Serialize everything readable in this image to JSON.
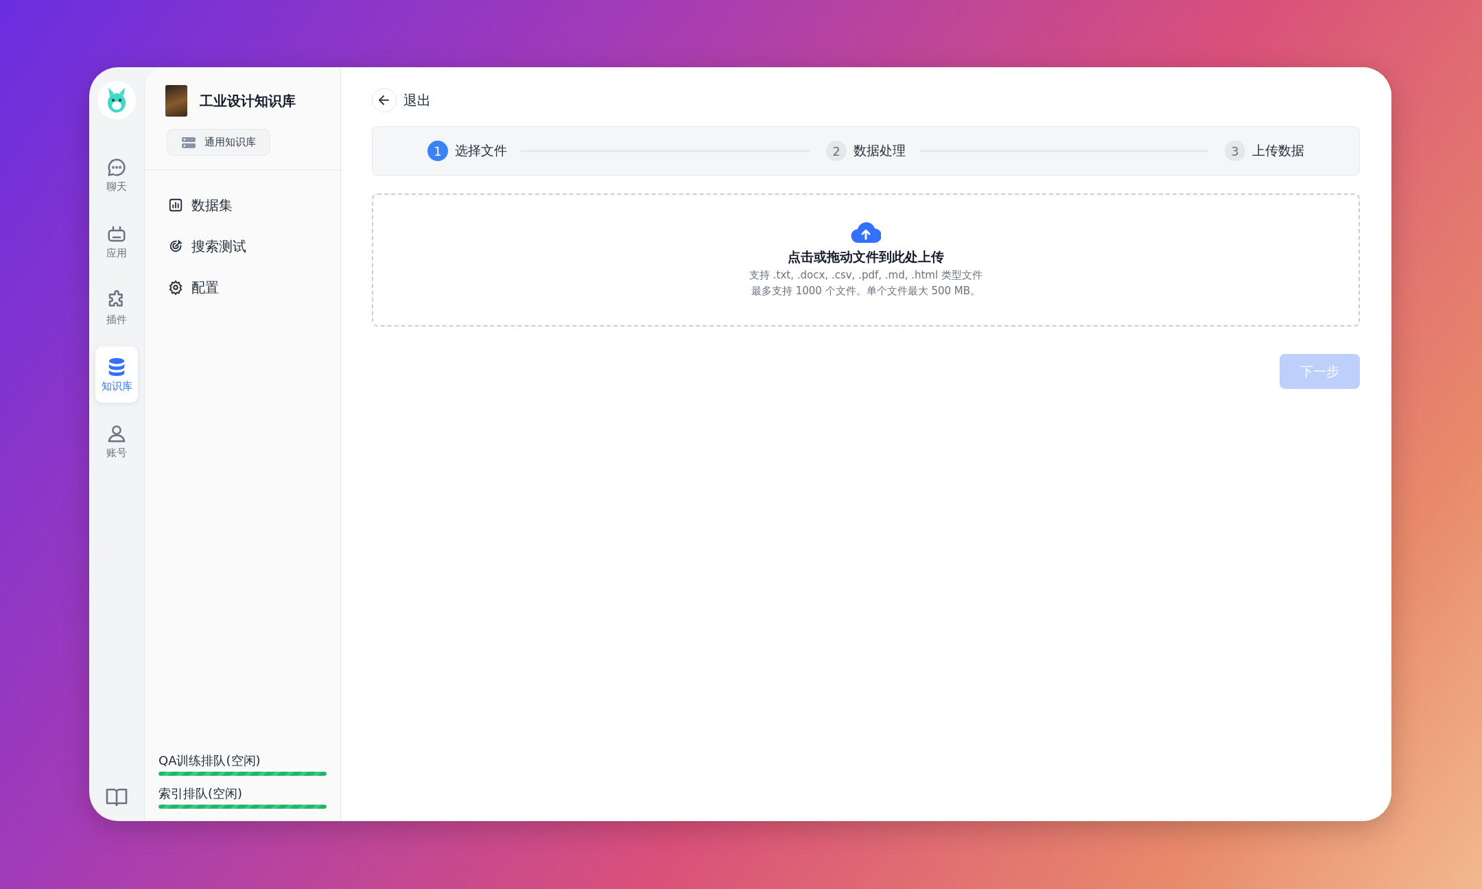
{
  "nav": [
    {
      "label": "聊天",
      "kind": "chat",
      "selected": false
    },
    {
      "label": "应用",
      "kind": "robot",
      "selected": false
    },
    {
      "label": "插件",
      "kind": "puzzle",
      "selected": false
    },
    {
      "label": "知识库",
      "kind": "database",
      "selected": true
    },
    {
      "label": "账号",
      "kind": "user",
      "selected": false
    }
  ],
  "knowledge_base": {
    "title": "工业设计知识库",
    "type_tag": "通用知识库"
  },
  "sidebar": {
    "items": [
      {
        "label": "数据集",
        "kind": "chart"
      },
      {
        "label": "搜索测试",
        "kind": "target"
      },
      {
        "label": "配置",
        "kind": "gear"
      }
    ]
  },
  "queues": [
    {
      "label": "QA训练排队(空闲)",
      "level": 1
    },
    {
      "label": "索引排队(空闲)",
      "level": 1
    }
  ],
  "back": {
    "label": "退出"
  },
  "steps": [
    {
      "number": "1",
      "label": "选择文件",
      "selected": true
    },
    {
      "number": "2",
      "label": "数据处理",
      "selected": false
    },
    {
      "number": "3",
      "label": "上传数据",
      "selected": false
    }
  ],
  "upload": {
    "title": "点击或拖动文件到此处上传",
    "hint": "支持 .txt, .docx, .csv, .pdf, .md, .html 类型文件",
    "limit": "最多支持 1000 个文件。单个文件最大 500 MB。"
  },
  "next_button": {
    "label": "下一步",
    "disabled": true
  }
}
